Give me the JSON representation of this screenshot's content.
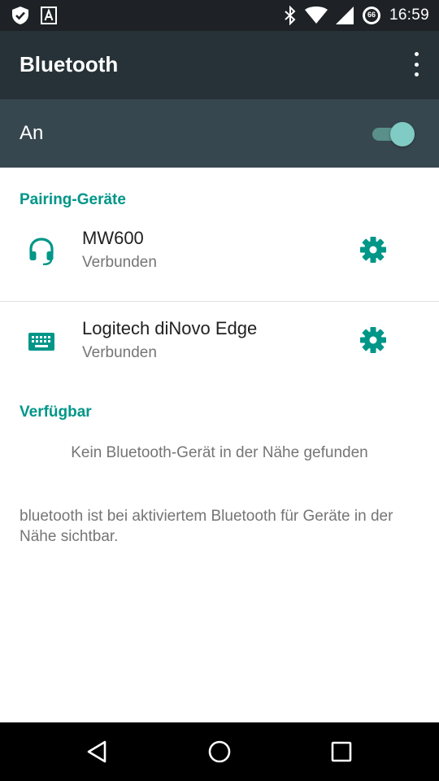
{
  "status_bar": {
    "time": "16:59",
    "battery_level": "66",
    "icons": [
      "shield-check-icon",
      "a-notification-icon",
      "bluetooth-icon",
      "wifi-icon",
      "signal-icon",
      "battery-icon"
    ]
  },
  "app_bar": {
    "title": "Bluetooth",
    "menu_icon": "more-vert-icon"
  },
  "master_switch": {
    "label": "An",
    "state": "on"
  },
  "paired_section": {
    "header": "Pairing-Geräte",
    "devices": [
      {
        "name": "MW600",
        "status": "Verbunden",
        "icon": "headset-icon"
      },
      {
        "name": "Logitech diNovo Edge",
        "status": "Verbunden",
        "icon": "keyboard-icon"
      }
    ]
  },
  "available_section": {
    "header": "Verfügbar",
    "empty_message": "Kein Bluetooth-Gerät in der Nähe gefunden"
  },
  "footer": {
    "text": "bluetooth ist bei aktiviertem Bluetooth für Geräte in der Nähe sichtbar."
  },
  "nav_bar": {
    "buttons": [
      "back-icon",
      "home-icon",
      "recents-icon"
    ]
  },
  "colors": {
    "accent": "#009688",
    "app_bar": "#263238",
    "switch_bar": "#37474f",
    "status_bar": "#1e2226"
  }
}
